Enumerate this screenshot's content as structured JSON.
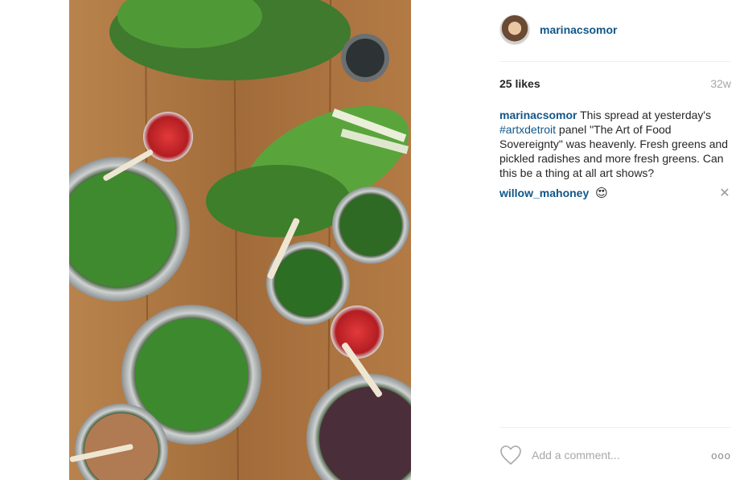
{
  "post": {
    "author": "marinacsomor",
    "likes": "25 likes",
    "age": "32w",
    "caption": {
      "user": "marinacsomor",
      "text_before": " This spread at yesterday's ",
      "hashtag": "#artxdetroit",
      "text_after": " panel \"The Art of Food Sovereignty\" was heavenly. Fresh greens and pickled radishes and more fresh greens. Can this be a thing at all art shows?"
    },
    "comments": [
      {
        "user": "willow_mahoney",
        "emoji": "😍"
      }
    ],
    "add_comment_placeholder": "Add a comment...",
    "more_label": "ooo"
  },
  "icons": {
    "heart": "heart-icon",
    "close": "close-icon",
    "more": "more-options-icon"
  },
  "colors": {
    "link": "#125688",
    "muted": "#a5a7aa",
    "divider": "#efefef"
  }
}
